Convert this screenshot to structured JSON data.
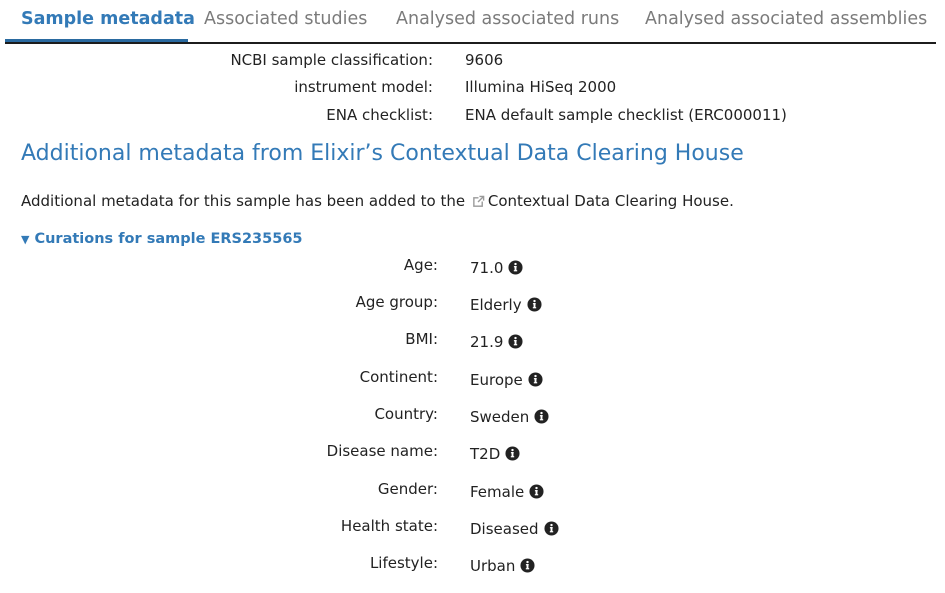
{
  "tabs": [
    {
      "label": "Sample metadata",
      "active": true
    },
    {
      "label": "Associated studies",
      "active": false
    },
    {
      "label": "Analysed associated runs",
      "active": false
    },
    {
      "label": "Analysed associated assemblies",
      "active": false
    }
  ],
  "metadata": [
    {
      "label": "NCBI sample classification:",
      "value": "9606"
    },
    {
      "label": "instrument model:",
      "value": "Illumina HiSeq 2000"
    },
    {
      "label": "ENA checklist:",
      "value": "ENA default sample checklist (ERC000011)"
    }
  ],
  "section": {
    "title": "Additional metadata from Elixir’s Contextual Data Clearing House",
    "desc_prefix": "Additional metadata for this sample has been added to the",
    "link_text": "Contextual Data Clearing House."
  },
  "curations": {
    "summary": "Curations for sample ERS235565",
    "items": [
      {
        "label": "Age:",
        "value": "71.0"
      },
      {
        "label": "Age group:",
        "value": "Elderly"
      },
      {
        "label": "BMI:",
        "value": "21.9"
      },
      {
        "label": "Continent:",
        "value": "Europe"
      },
      {
        "label": "Country:",
        "value": "Sweden"
      },
      {
        "label": "Disease name:",
        "value": "T2D"
      },
      {
        "label": "Gender:",
        "value": "Female"
      },
      {
        "label": "Health state:",
        "value": "Diseased"
      },
      {
        "label": "Lifestyle:",
        "value": "Urban"
      }
    ]
  },
  "colors": {
    "link": "#337ab7",
    "text": "#222222",
    "tab_inactive": "#7b7b7b"
  },
  "icons": {
    "info": "info-circle-icon",
    "external": "external-link-icon",
    "disclosure": "triangle-down-icon"
  }
}
